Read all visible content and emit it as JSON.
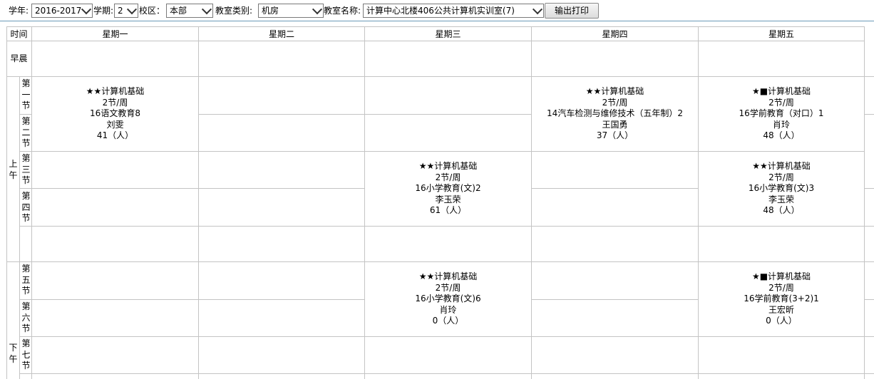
{
  "toolbar": {
    "year_label": "学年:",
    "year_value": "2016-2017",
    "term_label": "学期:",
    "term_value": "2",
    "campus_label": "校区：",
    "campus_value": "本部",
    "room_type_label": "教室类别:",
    "room_type_value": "机房",
    "room_name_label": "教室名称:",
    "room_name_value": "计算中心北楼406公共计算机实训室(7)",
    "print_button": "输出打印"
  },
  "header": {
    "time": "时间",
    "days": [
      "星期一",
      "星期二",
      "星期三",
      "星期四",
      "星期五"
    ]
  },
  "rows": {
    "morning_early": "早晨",
    "am": "上午",
    "pm": "下午",
    "p1": "第一节",
    "p2": "第二节",
    "p3": "第三节",
    "p4": "第四节",
    "p5": "第五节",
    "p6": "第六节",
    "p7": "第七节"
  },
  "courses": [
    {
      "day": "星期一",
      "periods": "1-2",
      "name": "★★计算机基础",
      "hours": "2节/周",
      "class": "16语文教育8",
      "teacher": "刘雯",
      "count": "41（人）"
    },
    {
      "day": "星期四",
      "periods": "1-2",
      "name": "★★计算机基础",
      "hours": "2节/周",
      "class": "14汽车检测与维修技术（五年制）2",
      "teacher": "王国勇",
      "count": "37（人）"
    },
    {
      "day": "星期五",
      "periods": "1-2",
      "name": "★■计算机基础",
      "hours": "2节/周",
      "class": "16学前教育（对口）1",
      "teacher": "肖玲",
      "count": "48（人）"
    },
    {
      "day": "星期三",
      "periods": "3-4",
      "name": "★★计算机基础",
      "hours": "2节/周",
      "class": "16小学教育(文)2",
      "teacher": "李玉荣",
      "count": "61（人）"
    },
    {
      "day": "星期五",
      "periods": "3-4",
      "name": "★★计算机基础",
      "hours": "2节/周",
      "class": "16小学教育(文)3",
      "teacher": "李玉荣",
      "count": "48（人）"
    },
    {
      "day": "星期三",
      "periods": "5-6",
      "name": "★★计算机基础",
      "hours": "2节/周",
      "class": "16小学教育(文)6",
      "teacher": "肖玲",
      "count": "0（人）"
    },
    {
      "day": "星期五",
      "periods": "5-6",
      "name": "★■计算机基础",
      "hours": "2节/周",
      "class": "16学前教育(3+2)1",
      "teacher": "王宏昕",
      "count": "0（人）"
    }
  ]
}
